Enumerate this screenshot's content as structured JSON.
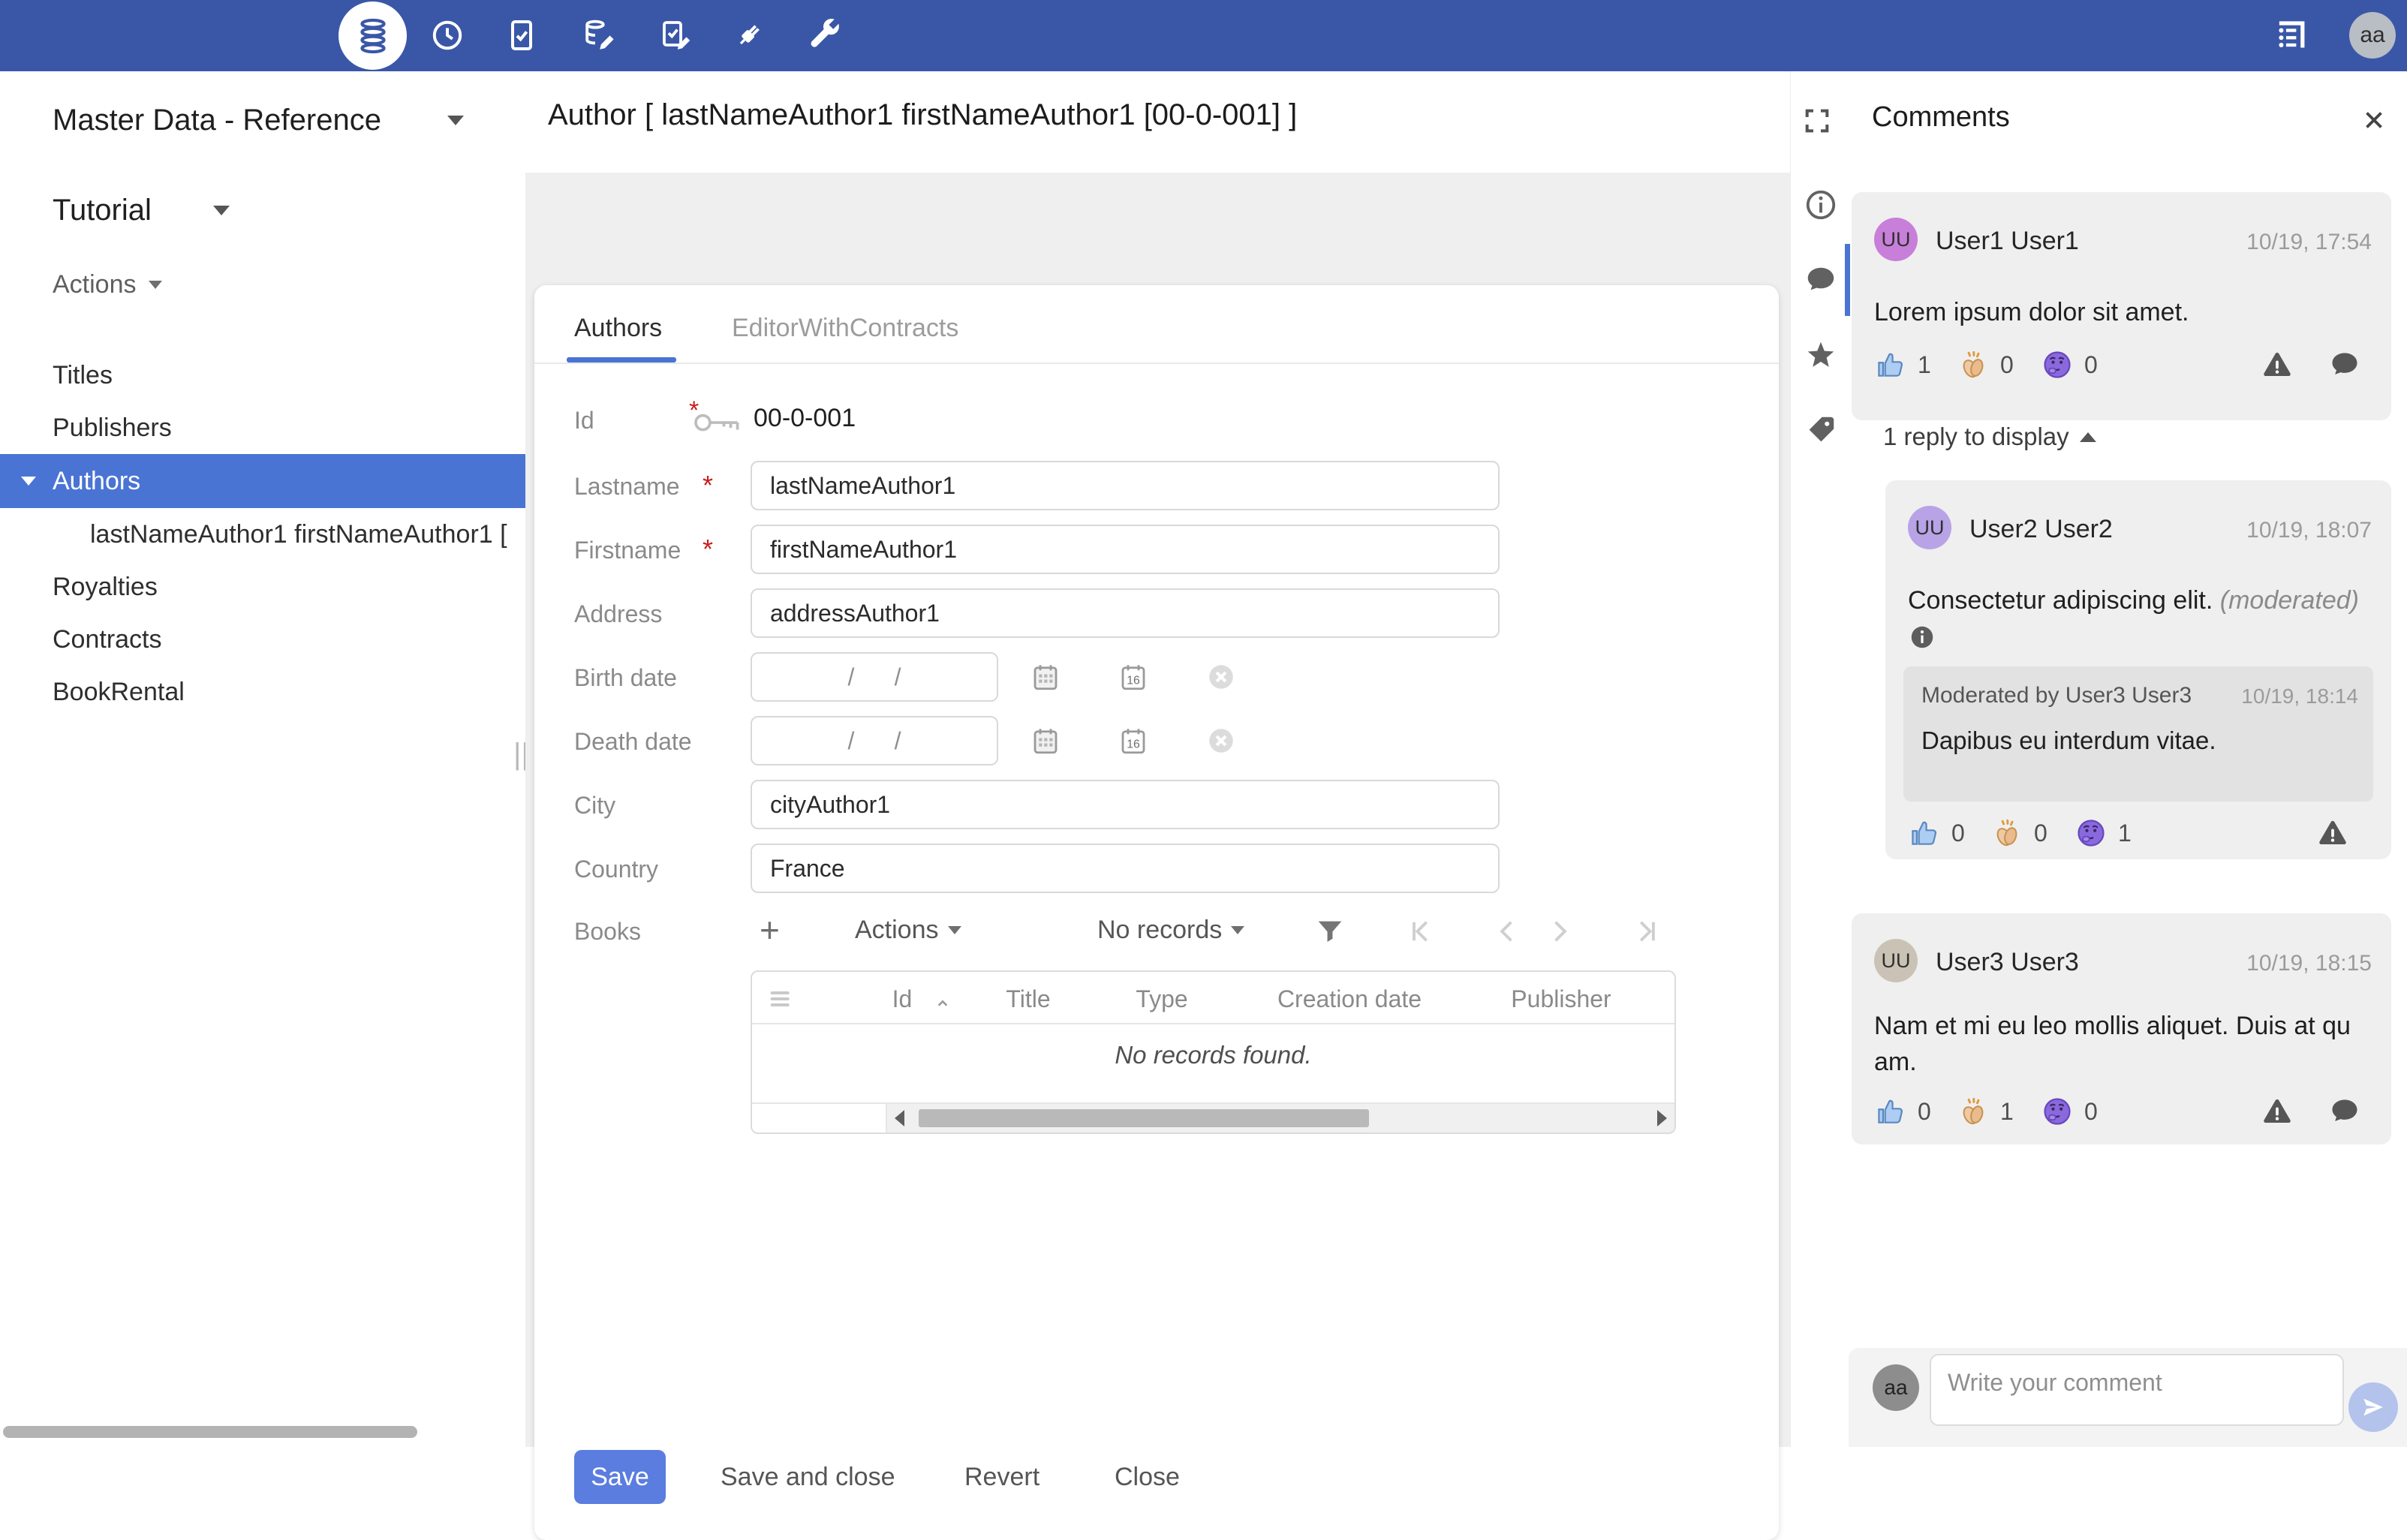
{
  "topbar": {
    "icons": [
      "database",
      "history-clock",
      "checklist",
      "database-edit",
      "check-edit",
      "plug",
      "wrench",
      "form-list"
    ],
    "avatar": "aa"
  },
  "sidebar": {
    "workspace": "Master Data - Reference",
    "module": "Tutorial",
    "actions": "Actions",
    "items": {
      "titles": "Titles",
      "publishers": "Publishers",
      "authors": "Authors",
      "author_record": "lastNameAuthor1 firstNameAuthor1 [",
      "royalties": "Royalties",
      "contracts": "Contracts",
      "bookrental": "BookRental"
    }
  },
  "content": {
    "title": "Author [ lastNameAuthor1 firstNameAuthor1 [00-0-001] ]",
    "tabs": {
      "authors": "Authors",
      "editor": "EditorWithContracts"
    },
    "form": {
      "id": {
        "label": "Id",
        "value": "00-0-001"
      },
      "lastname": {
        "label": "Lastname",
        "required": "*",
        "value": "lastNameAuthor1"
      },
      "firstname": {
        "label": "Firstname",
        "required": "*",
        "value": "firstNameAuthor1"
      },
      "address": {
        "label": "Address",
        "value": "addressAuthor1"
      },
      "birth_date": {
        "label": "Birth date",
        "placeholder": "/      /"
      },
      "death_date": {
        "label": "Death date",
        "placeholder": "/      /"
      },
      "city": {
        "label": "City",
        "value": "cityAuthor1"
      },
      "country": {
        "label": "Country",
        "value": "France"
      },
      "books": {
        "label": "Books"
      }
    },
    "books": {
      "add": "+",
      "actions": "Actions",
      "pager": "No records",
      "columns": {
        "id": "Id",
        "title": "Title",
        "type": "Type",
        "creation_date": "Creation date",
        "publisher": "Publisher"
      },
      "empty": "No records found.",
      "calendar_day": "16"
    },
    "buttons": {
      "save": "Save",
      "save_close": "Save and close",
      "revert": "Revert",
      "close": "Close"
    }
  },
  "comments": {
    "title": "Comments",
    "c1": {
      "initials": "UU",
      "name": "User1 User1",
      "time": "10/19, 17:54",
      "text": "Lorem ipsum dolor sit amet.",
      "likes": "1",
      "claps": "0",
      "thinks": "0"
    },
    "reply_toggle": "1 reply to display",
    "c2": {
      "initials": "UU",
      "name": "User2 User2",
      "time": "10/19, 18:07",
      "text": "Consectetur adipiscing elit.",
      "moderated_tag": "(moderated)",
      "likes": "0",
      "claps": "0",
      "thinks": "1",
      "moderation": {
        "title": "Moderated by User3 User3",
        "time": "10/19, 18:14",
        "text": "Dapibus eu interdum vitae."
      }
    },
    "c3": {
      "initials": "UU",
      "name": "User3 User3",
      "time": "10/19, 18:15",
      "text": "Nam et mi eu leo mollis aliquet. Duis at quam.",
      "likes": "0",
      "claps": "1",
      "thinks": "0"
    },
    "composer": {
      "avatar": "aa",
      "placeholder": "Write your comment"
    }
  },
  "colors": {
    "topbar": "#3a57a7",
    "selection_blue": "#4a74d4",
    "primary_button": "#5b7de0",
    "avatar_user1": "#c77fd9",
    "avatar_user2": "#b7a3e6",
    "avatar_user3": "#cac2b5",
    "avatar_me": "#8d8d8d",
    "card_gray": "#efefef",
    "moderation_gray": "#e2e2e2"
  }
}
